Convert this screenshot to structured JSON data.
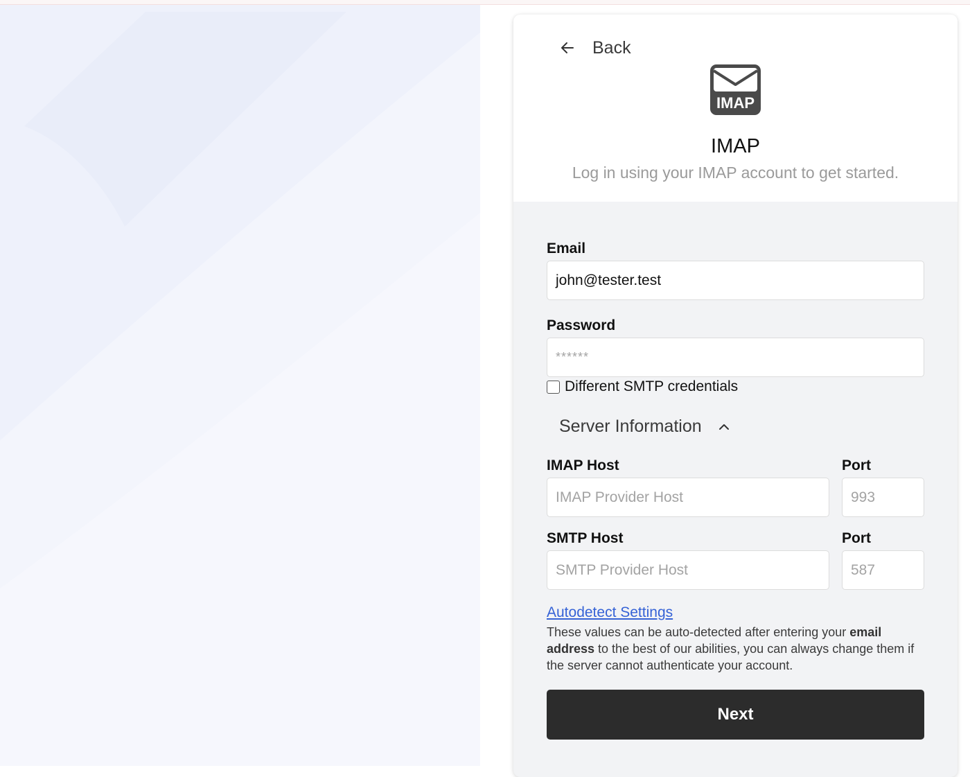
{
  "header": {
    "back_label": "Back",
    "logo_text": "IMAP",
    "title": "IMAP",
    "subtitle": "Log in using your IMAP account to get started."
  },
  "form": {
    "email": {
      "label": "Email",
      "value": "john@tester.test"
    },
    "password": {
      "label": "Password",
      "value": "******"
    },
    "smtp_checkbox": {
      "label": "Different SMTP credentials",
      "checked": false
    },
    "server_section": {
      "label": "Server Information",
      "expanded": true
    },
    "imap_host": {
      "label": "IMAP Host",
      "placeholder": "IMAP Provider Host"
    },
    "imap_port": {
      "label": "Port",
      "placeholder": "993"
    },
    "smtp_host": {
      "label": "SMTP Host",
      "placeholder": "SMTP Provider Host"
    },
    "smtp_port": {
      "label": "Port",
      "placeholder": "587"
    },
    "autodetect_link": "Autodetect Settings",
    "help_text_1": "These values can be auto-detected after entering your ",
    "help_text_bold": "email address",
    "help_text_2": " to the best of our abilities, you can always change them if the server cannot authenticate your account.",
    "next_label": "Next"
  },
  "colors": {
    "left_background": "#eef1fb",
    "card_background": "#f2f3f5",
    "button": "#2c2c2c",
    "link": "#3562d6"
  },
  "icons": {
    "back": "arrow-left-icon",
    "logo": "envelope-imap-icon",
    "chevron": "chevron-up-icon"
  }
}
